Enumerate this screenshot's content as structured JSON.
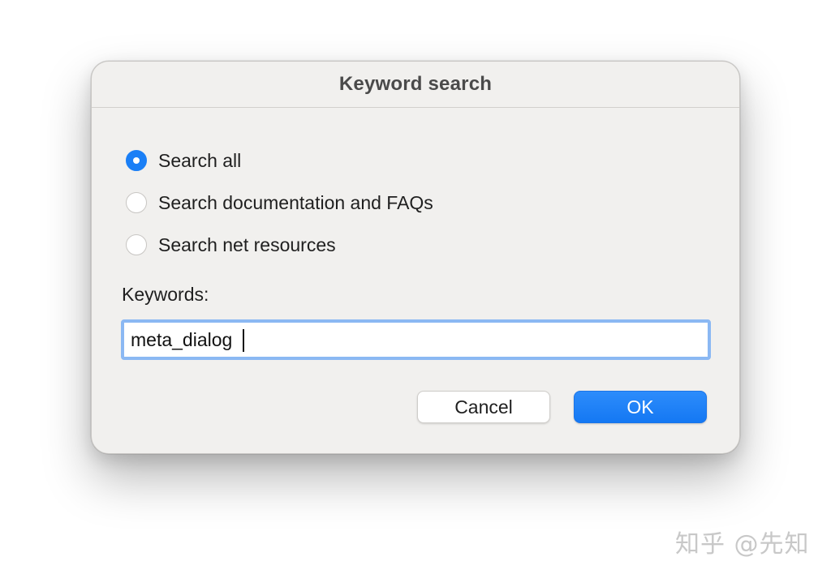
{
  "dialog": {
    "title": "Keyword search",
    "options": [
      {
        "label": "Search all",
        "checked": true
      },
      {
        "label": "Search documentation and FAQs",
        "checked": false
      },
      {
        "label": "Search net resources",
        "checked": false
      }
    ],
    "keywords_label": "Keywords:",
    "keywords_value": "meta_dialog",
    "cancel_label": "Cancel",
    "ok_label": "OK"
  },
  "colors": {
    "accent": "#1a7ff6",
    "dialog_bg": "#f1f0ee",
    "focus_ring": "#8bb8f3"
  },
  "watermark": {
    "text": "知乎 @先知"
  }
}
